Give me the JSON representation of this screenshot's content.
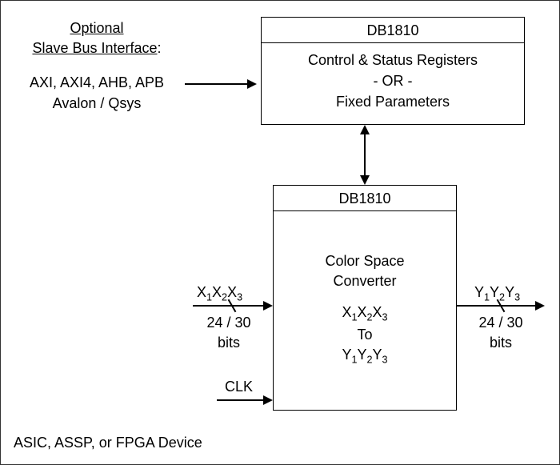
{
  "slave_interface": {
    "heading_optional": "Optional",
    "heading_label": "Slave Bus Interface",
    "buses_line1": "AXI, AXI4, AHB, APB",
    "buses_line2": "Avalon / Qsys"
  },
  "top_block": {
    "title": "DB1810",
    "body_line1": "Control & Status Registers",
    "body_line2": "- OR -",
    "body_line3": "Fixed Parameters"
  },
  "main_block": {
    "title": "DB1810",
    "body_line1": "Color Space",
    "body_line2": "Converter",
    "x_label": "X",
    "y_label": "Y",
    "to_label": "To"
  },
  "signals": {
    "input_label": "X",
    "output_label": "Y",
    "bits_label": "24 / 30",
    "bits_unit": "bits",
    "clk_label": "CLK"
  },
  "footer": "ASIC, ASSP, or FPGA  Device"
}
